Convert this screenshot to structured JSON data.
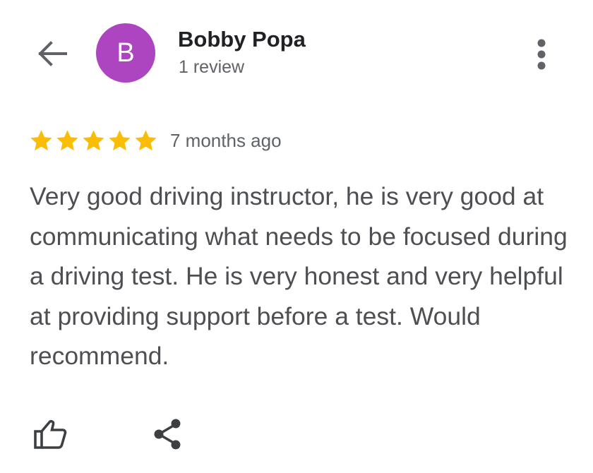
{
  "colors": {
    "avatar_background": "#ad45c0",
    "star": "#fbbc04",
    "icon": "#5f6368",
    "text_primary": "#202124",
    "text_secondary": "#5f6368"
  },
  "header": {
    "back_icon": "arrow-left-icon",
    "avatar_initial": "B",
    "author_name": "Bobby Popa",
    "review_count": "1 review",
    "more_icon": "more-vert-icon"
  },
  "review": {
    "rating": 5,
    "rating_max": 5,
    "date": "7 months ago",
    "text": "Very good driving instructor, he is very good at communicating what needs to be focused during a driving test. He is very honest and very helpful at providing support before a test. Would recommend."
  },
  "actions": {
    "like_icon": "thumbs-up-icon",
    "share_icon": "share-icon"
  }
}
